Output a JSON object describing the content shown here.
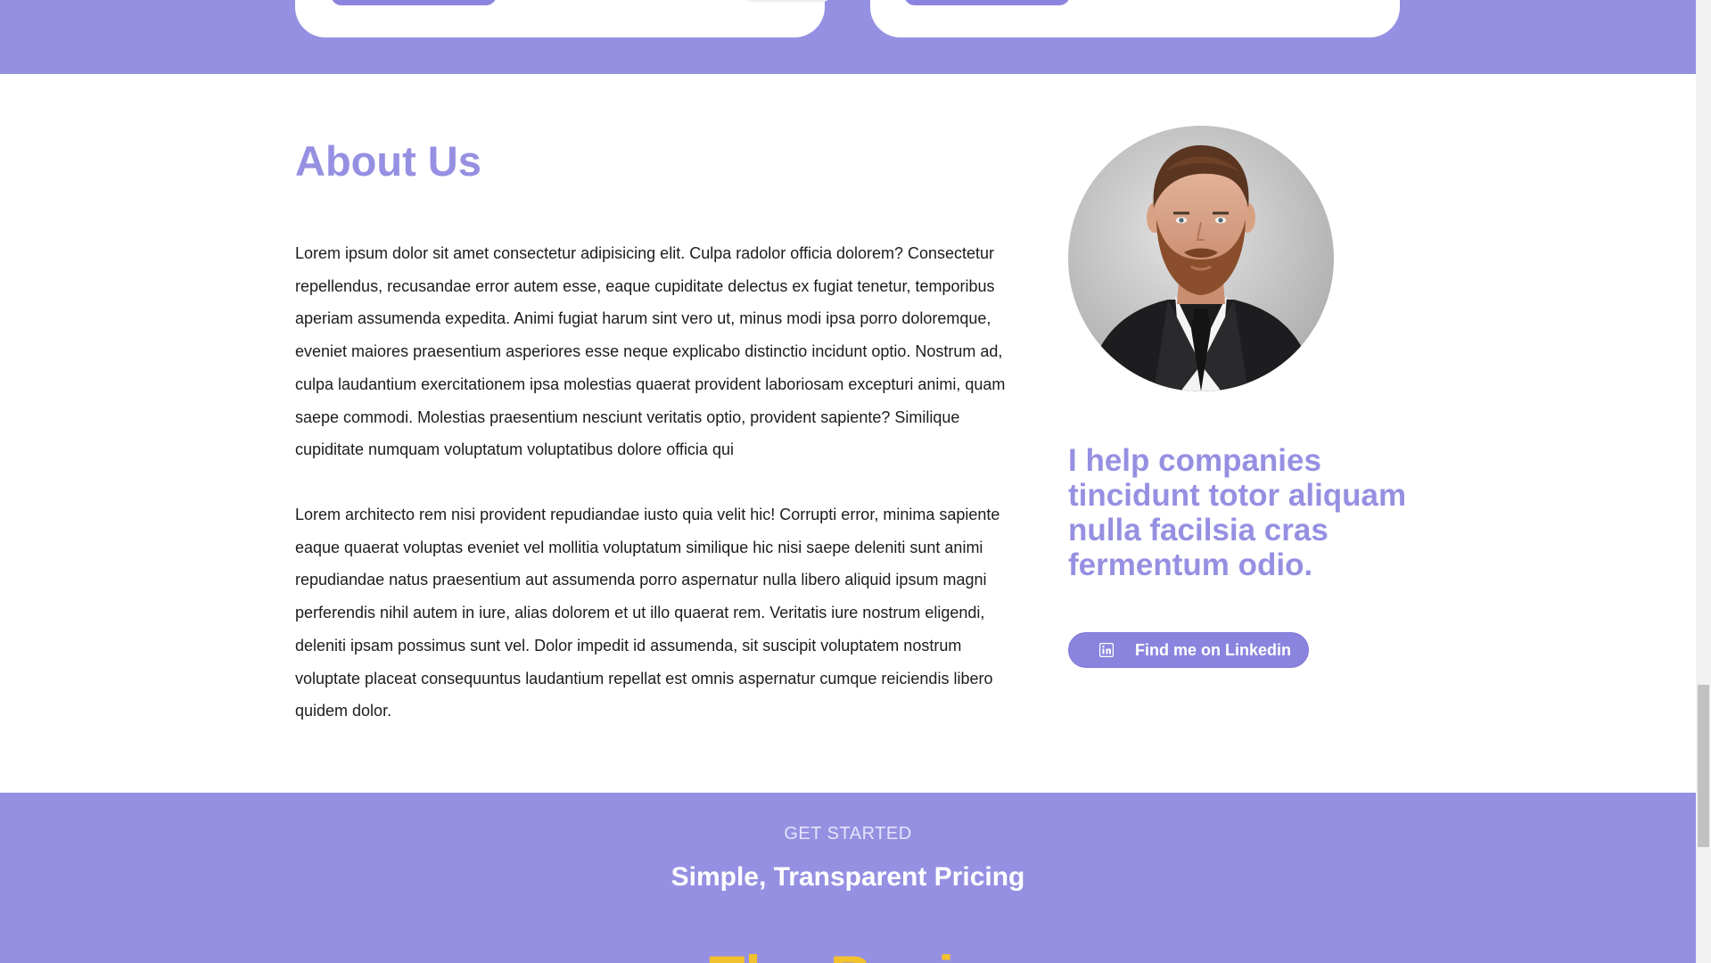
{
  "colors": {
    "accent": "#9690e2",
    "button": "#8b84de",
    "plan_yellow": "#f2c12e",
    "text": "#1c1c1c"
  },
  "about": {
    "title": "About Us",
    "paragraphs": [
      "Lorem ipsum dolor sit amet consectetur adipisicing elit. Culpa radolor officia dolorem? Consectetur repellendus, recusandae error autem esse, eaque cupiditate delectus ex fugiat tenetur, temporibus aperiam assumenda expedita. Animi fugiat harum sint vero ut, minus modi ipsa porro doloremque, eveniet maiores praesentium asperiores esse neque explicabo distinctio incidunt optio. Nostrum ad, culpa laudantium exercitationem ipsa molestias quaerat provident laboriosam excepturi animi, quam saepe commodi. Molestias praesentium nesciunt veritatis optio, provident sapiente? Similique cupiditate numquam voluptatum voluptatibus dolore officia qui",
      "Lorem architecto rem nisi provident repudiandae iusto quia velit hic! Corrupti error, minima sapiente eaque quaerat voluptas eveniet vel mollitia voluptatum similique hic nisi saepe deleniti sunt animi repudiandae natus praesentium aut assumenda porro aspernatur nulla libero aliquid ipsum magni perferendis nihil autem in iure, alias dolorem et ut illo quaerat rem. Veritatis iure nostrum eligendi, deleniti ipsam possimus sunt vel. Dolor impedit id assumenda, sit suscipit voluptatem nostrum voluptate placeat consequuntus laudantium repellat est omnis aspernatur cumque reiciendis libero quidem dolor."
    ],
    "tagline": "I help companies tincidunt totor aliquam nulla facilsia cras fermentum odio.",
    "linkedin_button": "Find me on Linkedin",
    "linkedin_icon": "linkedin-icon"
  },
  "pricing": {
    "eyebrow": "GET STARTED",
    "title": "Simple, Transparent Pricing",
    "plan_name": "The Basic"
  }
}
